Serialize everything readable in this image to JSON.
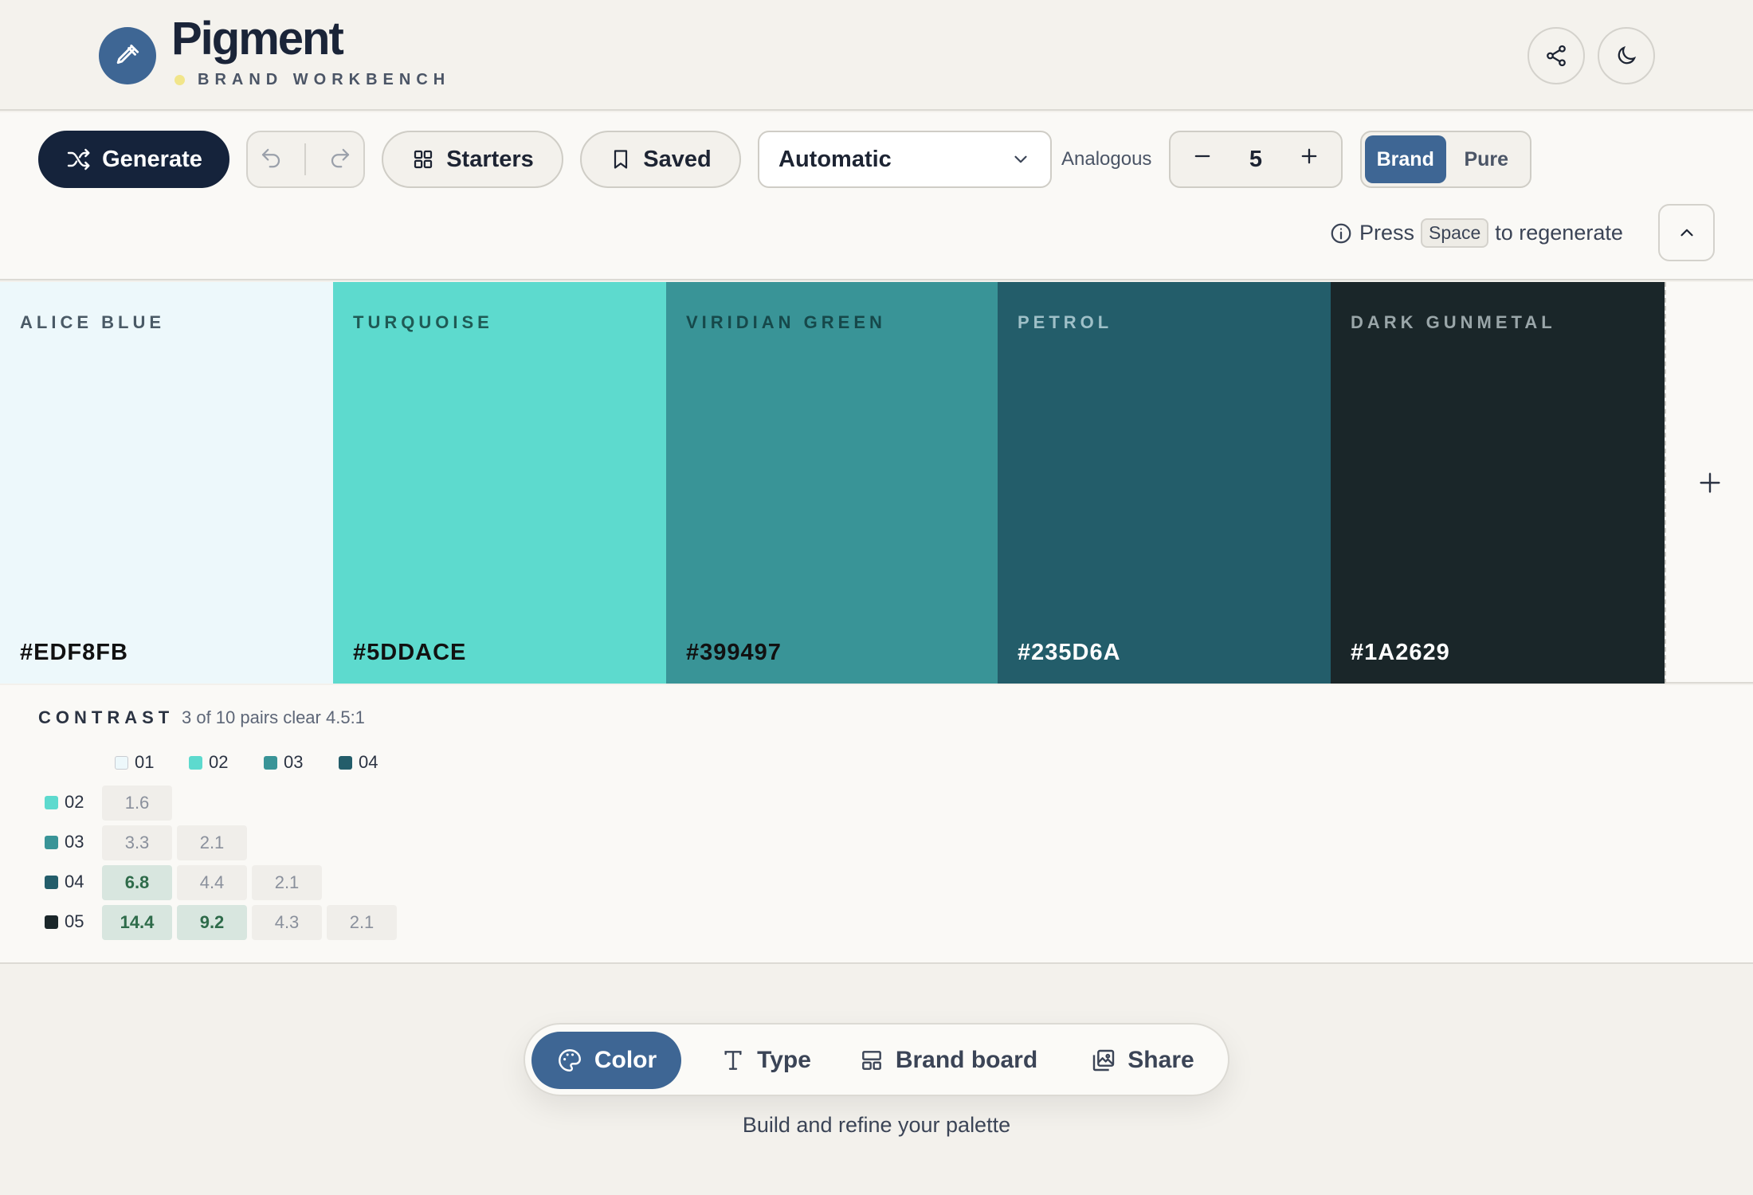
{
  "app": {
    "title": "Pigment",
    "subtitle": "BRAND WORKBENCH"
  },
  "header": {
    "share_icon": "share-icon",
    "theme_icon": "moon-icon"
  },
  "toolbar": {
    "generate_label": "Generate",
    "starters_label": "Starters",
    "saved_label": "Saved",
    "mode_select_value": "Automatic",
    "harmony_label": "Analogous",
    "count_value": "5",
    "color_mode_options": [
      "Brand",
      "Pure"
    ],
    "color_mode_selected": "Brand",
    "hint_prefix": "Press",
    "hint_key": "Space",
    "hint_suffix": "to regenerate"
  },
  "palette": [
    {
      "name": "ALICE BLUE",
      "hex": "#EDF8FB",
      "color": "#EDF8FB",
      "text_color": "#4a5a66"
    },
    {
      "name": "TURQUOISE",
      "hex": "#5DDACE",
      "color": "#5DDACE",
      "text_color": "#1f5a55"
    },
    {
      "name": "VIRIDIAN GREEN",
      "hex": "#399497",
      "color": "#399497",
      "text_color": "#16484a"
    },
    {
      "name": "PETROL",
      "hex": "#235D6A",
      "color": "#235D6A",
      "text_color": "#9fc0c8"
    },
    {
      "name": "DARK GUNMETAL",
      "hex": "#1A2629",
      "color": "#1A2629",
      "text_color": "#9aa6a9"
    }
  ],
  "contrast": {
    "title": "CONTRAST",
    "summary": "3 of 10 pairs clear 4.5:1",
    "columns": [
      {
        "label": "01",
        "color": "#EDF8FB"
      },
      {
        "label": "02",
        "color": "#5DDACE"
      },
      {
        "label": "03",
        "color": "#399497"
      },
      {
        "label": "04",
        "color": "#235D6A"
      }
    ],
    "rows": [
      {
        "label": "02",
        "color": "#5DDACE",
        "values": [
          "1.6"
        ],
        "pass": [
          false
        ]
      },
      {
        "label": "03",
        "color": "#399497",
        "values": [
          "3.3",
          "2.1"
        ],
        "pass": [
          false,
          false
        ]
      },
      {
        "label": "04",
        "color": "#235D6A",
        "values": [
          "6.8",
          "4.4",
          "2.1"
        ],
        "pass": [
          true,
          false,
          false
        ]
      },
      {
        "label": "05",
        "color": "#1A2629",
        "values": [
          "14.4",
          "9.2",
          "4.3",
          "2.1"
        ],
        "pass": [
          true,
          true,
          false,
          false
        ]
      }
    ]
  },
  "nav": {
    "items": [
      {
        "label": "Color",
        "icon": "palette-icon",
        "active": true
      },
      {
        "label": "Type",
        "icon": "type-icon",
        "active": false
      },
      {
        "label": "Brand board",
        "icon": "layout-icon",
        "active": false
      },
      {
        "label": "Share",
        "icon": "images-icon",
        "active": false
      }
    ],
    "caption": "Build and refine your palette"
  },
  "colors": {
    "accent": "#3E6694",
    "dark": "#15233B",
    "pass_bg": "#D8E6DF",
    "pass_text": "#2E6B4A"
  }
}
